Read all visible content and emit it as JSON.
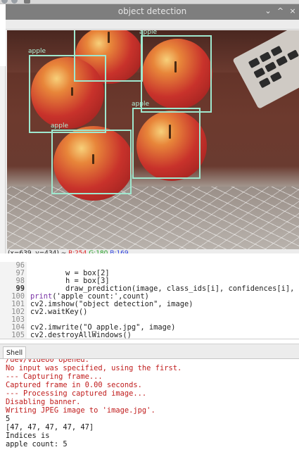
{
  "window": {
    "title": "object detection"
  },
  "title_buttons": [
    "⌄",
    "^",
    "×"
  ],
  "icons": {
    "minimize": "chevron-down-icon",
    "maximize": "chevron-up-icon",
    "close": "close-icon"
  },
  "colors": {
    "box": "#9fe8cf",
    "label": "#aef0d8",
    "error_text": "#c01c1c",
    "keyword": "#7a33a6",
    "string": "#b8860b"
  },
  "detections": [
    {
      "label": "apple"
    },
    {
      "label": "apple"
    },
    {
      "label": "apple"
    },
    {
      "label": "apple"
    },
    {
      "label": "apple"
    }
  ],
  "status": {
    "coords": "(x=639, y=434) ~",
    "r": "R:254",
    "g": "G:180",
    "b": "B:169"
  },
  "editor": {
    "lines": [
      {
        "num": "96",
        "text": "        w = box[2]"
      },
      {
        "num": "97",
        "text": "        h = box[3]"
      },
      {
        "num": "98",
        "text": "        draw_prediction(image, class_ids[i], confidences[i], rou"
      },
      {
        "num": "99",
        "kw": "print",
        "text": "('apple count:',count)"
      },
      {
        "num": "100",
        "text": "cv2.imshow(\"object detection\", image)"
      },
      {
        "num": "101",
        "text": "cv2.waitKey()"
      },
      {
        "num": "102",
        "text": ""
      },
      {
        "num": "103",
        "text": "cv2.imwrite(\"O_apple.jpg\", image)"
      },
      {
        "num": "104",
        "text": "cv2.destroyAllWindows()"
      },
      {
        "num": "105",
        "text": ""
      }
    ]
  },
  "side_fragment": "l",
  "shell": {
    "tab_label": "Shell",
    "lines": [
      {
        "kind": "err",
        "text": "/dev/video0 opened."
      },
      {
        "kind": "err",
        "text": "No input was specified, using the first."
      },
      {
        "kind": "err",
        "text": "--- Capturing frame..."
      },
      {
        "kind": "err",
        "text": "Captured frame in 0.00 seconds."
      },
      {
        "kind": "err",
        "text": "--- Processing captured image..."
      },
      {
        "kind": "err",
        "text": "Disabling banner."
      },
      {
        "kind": "err",
        "text": "Writing JPEG image to 'image.jpg'."
      },
      {
        "kind": "out",
        "text": "5"
      },
      {
        "kind": "out",
        "text": "[47, 47, 47, 47, 47]"
      },
      {
        "kind": "out",
        "text": "Indices is"
      },
      {
        "kind": "out",
        "text": "apple count: 5"
      }
    ]
  }
}
